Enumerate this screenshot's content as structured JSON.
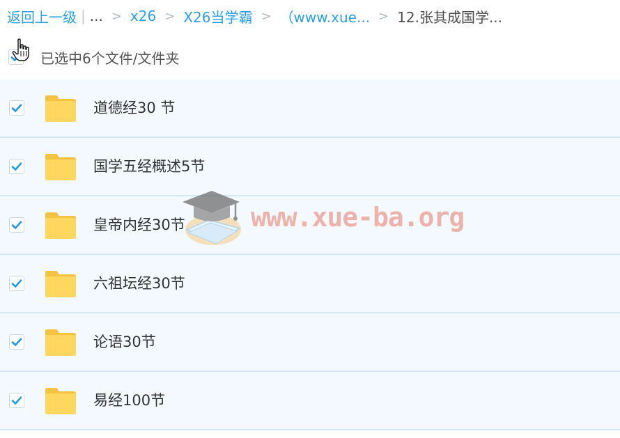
{
  "breadcrumb": {
    "back_label": "返回上一级",
    "ellipsis": "...",
    "items": [
      {
        "label": "x26"
      },
      {
        "label": "X26当学霸"
      },
      {
        "label": "（www.xue..."
      }
    ],
    "current": "12.张其成国学...",
    "separator": ">"
  },
  "selection": {
    "label": "已选中6个文件/文件夹",
    "checked": true
  },
  "files": [
    {
      "name": "道德经30 节",
      "checked": true,
      "icon": "folder-icon"
    },
    {
      "name": "国学五经概述5节",
      "checked": true,
      "icon": "folder-icon"
    },
    {
      "name": "皇帝内经30节",
      "checked": true,
      "icon": "folder-icon"
    },
    {
      "name": "六祖坛经30节",
      "checked": true,
      "icon": "folder-icon"
    },
    {
      "name": "论语30节",
      "checked": true,
      "icon": "folder-icon"
    },
    {
      "name": "易经100节",
      "checked": true,
      "icon": "folder-icon"
    }
  ],
  "watermark": {
    "text": "www.xue-ba.org",
    "icon": "graduation-cap-icon"
  },
  "colors": {
    "accent": "#2aa0ea",
    "row_bg": "#f3f9fe",
    "row_border": "#d4e7f7",
    "folder": "#ffd35c",
    "check": "#1e9be8"
  }
}
